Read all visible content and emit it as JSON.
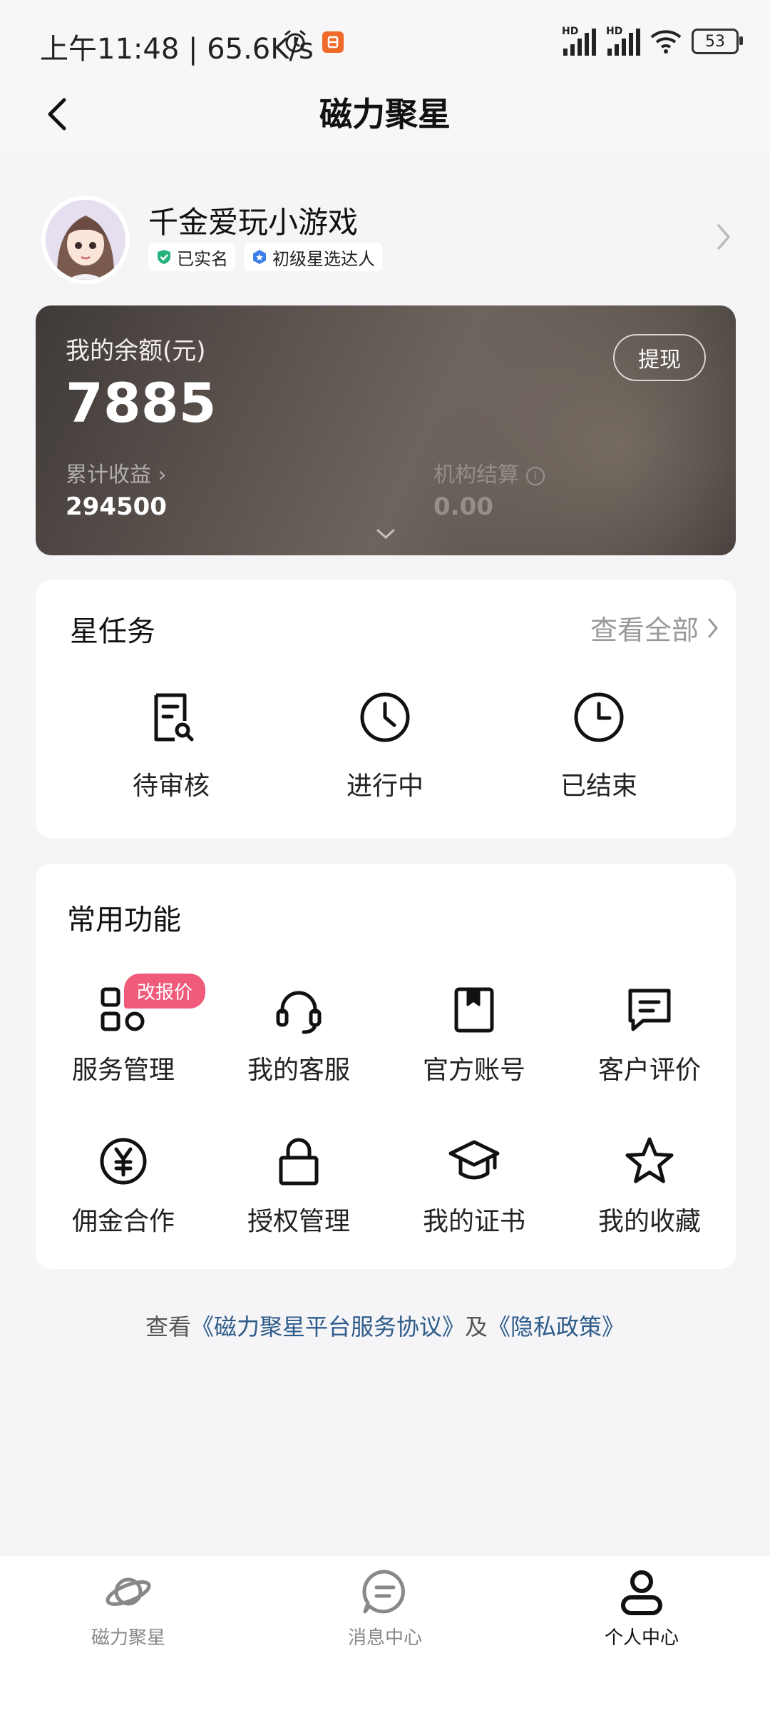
{
  "status_bar": {
    "time": "上午11:48 | 65.6K/s",
    "signal_label": "HD",
    "battery": "53"
  },
  "header": {
    "title": "磁力聚星"
  },
  "profile": {
    "name": "千金爱玩小游戏",
    "badges": [
      "已实名",
      "初级星选达人"
    ]
  },
  "balance": {
    "label": "我的余额(元)",
    "value": "7885",
    "withdraw": "提现",
    "cumulative_label": "累计收益",
    "cumulative_value": "294500",
    "org_label": "机构结算",
    "org_value": "0.00"
  },
  "tasks": {
    "title": "星任务",
    "view_all": "查看全部",
    "items": [
      {
        "label": "待审核",
        "icon": "document-search-icon"
      },
      {
        "label": "进行中",
        "icon": "clock-icon"
      },
      {
        "label": "已结束",
        "icon": "clock-icon"
      }
    ]
  },
  "functions": {
    "title": "常用功能",
    "promo_badge": "改报价",
    "items": [
      {
        "label": "服务管理",
        "icon": "apps-grid-icon"
      },
      {
        "label": "我的客服",
        "icon": "headset-icon"
      },
      {
        "label": "官方账号",
        "icon": "bookmark-book-icon"
      },
      {
        "label": "客户评价",
        "icon": "comment-icon"
      },
      {
        "label": "佣金合作",
        "icon": "yuan-coin-icon"
      },
      {
        "label": "授权管理",
        "icon": "lock-icon"
      },
      {
        "label": "我的证书",
        "icon": "graduation-cap-icon"
      },
      {
        "label": "我的收藏",
        "icon": "star-icon"
      }
    ]
  },
  "agreement": {
    "prefix": "查看",
    "link1": "《磁力聚星平台服务协议》",
    "middle": "及",
    "link2": "《隐私政策》"
  },
  "bottom_nav": {
    "items": [
      {
        "label": "磁力聚星",
        "icon": "planet-icon",
        "active": false
      },
      {
        "label": "消息中心",
        "icon": "message-icon",
        "active": false
      },
      {
        "label": "个人中心",
        "icon": "person-icon",
        "active": true
      }
    ]
  },
  "colors": {
    "accent_pink": "#f05b7c",
    "link_blue": "#2d5b8a",
    "verified_green": "#27b37a",
    "level_blue": "#3d7fe8"
  }
}
